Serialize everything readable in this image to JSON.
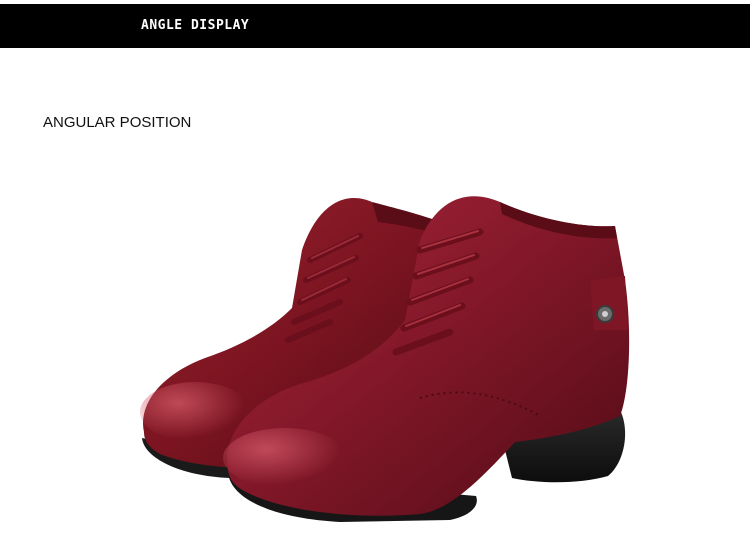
{
  "header": {
    "title": "ANGLE DISPLAY"
  },
  "section": {
    "label": "ANGULAR POSITION"
  },
  "photo": {
    "subject": "pair of burgundy leather lace-up ankle boots",
    "colors": {
      "leather": "#7a1420",
      "leather_highlight": "#b23a45",
      "sole": "#1c1c1c"
    }
  }
}
